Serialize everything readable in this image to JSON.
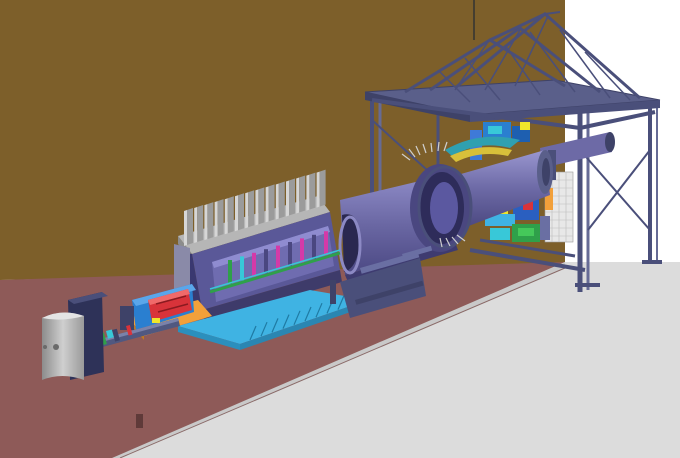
{
  "scene": {
    "kind": "3D CAD render of a beamline experimental hall",
    "colors": {
      "back_wall": "#7d5f2a",
      "back_wall_dark": "#6e521f",
      "floor": "#8e5a58",
      "floor_edge": "#6a3e3c",
      "platform": "#dcdcdc",
      "platform_side": "#c8c8c8",
      "steel": "#5a5f8a",
      "steel_dark": "#3e4268",
      "vessel": "#6d6aa6",
      "vessel_light": "#8c89c4",
      "vessel_dark": "#4a4780",
      "vacuum_tank": "#6a6fa3",
      "radiator": "#d6d6d6",
      "radiator_shadow": "#9b9b9b",
      "cyan_base": "#3fb3e3",
      "orange_plate": "#f2a03a",
      "blue_block": "#2a7fd0",
      "red_magnet": "#d8333a",
      "magenta": "#d43aa8",
      "yellow": "#f0e62a",
      "green": "#2fa04a",
      "cyan_box": "#38c8d8",
      "grey_shield": "#a9a9a9"
    }
  }
}
